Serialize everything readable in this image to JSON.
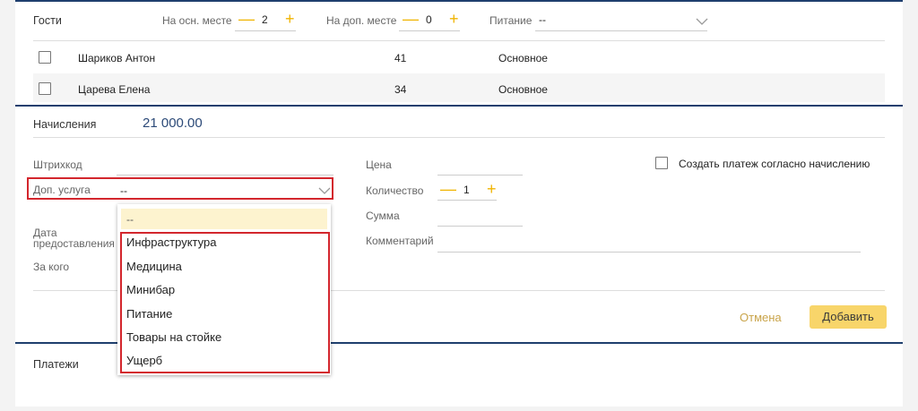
{
  "guests": {
    "title": "Гости",
    "main_place_label": "На осн. месте",
    "main_place_value": "2",
    "extra_place_label": "На доп. месте",
    "extra_place_value": "0",
    "food_label": "Питание",
    "food_value": "--",
    "rows": [
      {
        "name": "Шариков Антон",
        "number": "41",
        "type": "Основное"
      },
      {
        "name": "Царева Елена",
        "number": "34",
        "type": "Основное"
      }
    ]
  },
  "charges": {
    "title": "Начисления",
    "amount": "21 000.00",
    "barcode_label": "Штрихкод",
    "service_label": "Доп. услуга",
    "service_value": "--",
    "date_label_1": "Дата",
    "date_label_2": "предоставления",
    "for_whom_label": "За кого",
    "price_label": "Цена",
    "quantity_label": "Количество",
    "quantity_value": "1",
    "sum_label": "Сумма",
    "comment_label": "Комментарий",
    "create_payment_label": "Создать платеж согласно начислению",
    "cancel_label": "Отмена",
    "add_label": "Добавить"
  },
  "dropdown": {
    "options": [
      "--",
      "Инфраструктура",
      "Медицина",
      "Минибар",
      "Питание",
      "Товары на стойке",
      "Ущерб"
    ]
  },
  "payments": {
    "title": "Платежи"
  },
  "colors": {
    "accent_blue": "#1f3f6e",
    "highlight_red": "#d3262d",
    "button_yellow": "#f8d56a",
    "stepper_yellow": "#f0b400"
  }
}
